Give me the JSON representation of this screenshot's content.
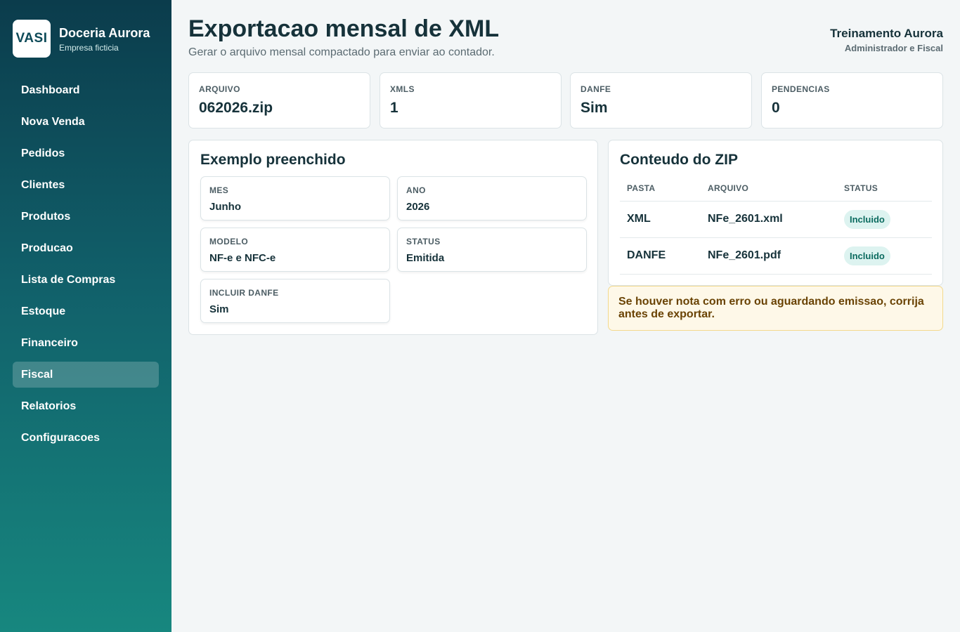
{
  "brand": {
    "logo": "VASI",
    "name": "Doceria Aurora",
    "subtitle": "Empresa ficticia"
  },
  "sidebar": {
    "items": [
      {
        "label": "Dashboard"
      },
      {
        "label": "Nova Venda"
      },
      {
        "label": "Pedidos"
      },
      {
        "label": "Clientes"
      },
      {
        "label": "Produtos"
      },
      {
        "label": "Producao"
      },
      {
        "label": "Lista de Compras"
      },
      {
        "label": "Estoque"
      },
      {
        "label": "Financeiro"
      },
      {
        "label": "Fiscal",
        "active": true
      },
      {
        "label": "Relatorios"
      },
      {
        "label": "Configuracoes"
      }
    ]
  },
  "header": {
    "title": "Exportacao mensal de XML",
    "subtitle": "Gerar o arquivo mensal compactado para enviar ao contador.",
    "user_name": "Treinamento Aurora",
    "user_role": "Administrador e Fiscal"
  },
  "stats": [
    {
      "label": "ARQUIVO",
      "value": "062026.zip"
    },
    {
      "label": "XMLS",
      "value": "1"
    },
    {
      "label": "DANFE",
      "value": "Sim"
    },
    {
      "label": "PENDENCIAS",
      "value": "0"
    }
  ],
  "example": {
    "title": "Exemplo preenchido",
    "fields": [
      {
        "label": "MES",
        "value": "Junho"
      },
      {
        "label": "ANO",
        "value": "2026"
      },
      {
        "label": "MODELO",
        "value": "NF-e e NFC-e"
      },
      {
        "label": "STATUS",
        "value": "Emitida"
      },
      {
        "label": "INCLUIR DANFE",
        "value": "Sim"
      }
    ]
  },
  "zip": {
    "title": "Conteudo do ZIP",
    "headers": [
      "PASTA",
      "ARQUIVO",
      "STATUS"
    ],
    "rows": [
      {
        "folder": "XML",
        "file": "NFe_2601.xml",
        "status": "Incluido"
      },
      {
        "folder": "DANFE",
        "file": "NFe_2601.pdf",
        "status": "Incluido"
      }
    ]
  },
  "warning": {
    "text": "Se houver nota com erro ou aguardando emissao, corrija antes de exportar."
  },
  "colors": {
    "accent": "#11606a",
    "badge_bg": "#ddf3f0",
    "warning_bg": "#fef8e8"
  }
}
